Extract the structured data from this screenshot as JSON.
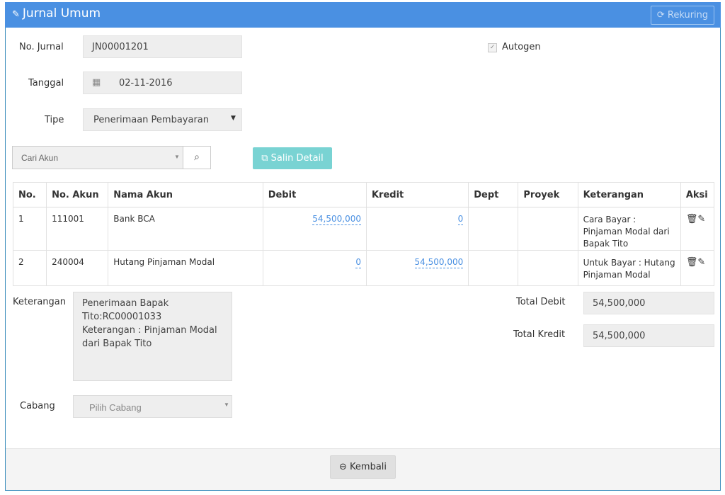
{
  "header": {
    "title": "Jurnal Umum",
    "title_icon": "edit-icon",
    "rekuring_label": "Rekuring",
    "rekuring_icon": "refresh-icon"
  },
  "form": {
    "no_jurnal_label": "No. Jurnal",
    "no_jurnal_value": "JN00001201",
    "autogen_label": "Autogen",
    "autogen_checked": true,
    "tanggal_label": "Tanggal",
    "tanggal_value": "02-11-2016",
    "tipe_label": "Tipe",
    "tipe_value": "Penerimaan Pembayaran"
  },
  "toolbar": {
    "cari_akun_placeholder": "Cari Akun",
    "salin_label": "Salin Detail"
  },
  "table": {
    "headers": [
      "No.",
      "No. Akun",
      "Nama Akun",
      "Debit",
      "Kredit",
      "Dept",
      "Proyek",
      "Keterangan",
      "Aksi"
    ],
    "rows": [
      {
        "no": "1",
        "akun": "111001",
        "nama": "Bank BCA",
        "debit": "54,500,000",
        "kredit": "0",
        "dept": "",
        "proyek": "",
        "ket": "Cara Bayar : Pinjaman Modal dari Bapak Tito"
      },
      {
        "no": "2",
        "akun": "240004",
        "nama": "Hutang Pinjaman Modal",
        "debit": "0",
        "kredit": "54,500,000",
        "dept": "",
        "proyek": "",
        "ket": "Untuk Bayar : Hutang Pinjaman Modal"
      }
    ]
  },
  "bottom": {
    "keterangan_label": "Keterangan",
    "keterangan_value": "Penerimaan Bapak Tito:RC00001033\nKeterangan : Pinjaman Modal dari Bapak Tito",
    "total_debit_label": "Total Debit",
    "total_debit_value": "54,500,000",
    "total_kredit_label": "Total Kredit",
    "total_kredit_value": "54,500,000",
    "cabang_label": "Cabang",
    "cabang_placeholder": "Pilih Cabang"
  },
  "footer": {
    "kembali_label": "Kembali"
  },
  "colors": {
    "header_bg": "#4a90e2",
    "link": "#4a90e2",
    "salin_bg": "#79d3d3"
  }
}
